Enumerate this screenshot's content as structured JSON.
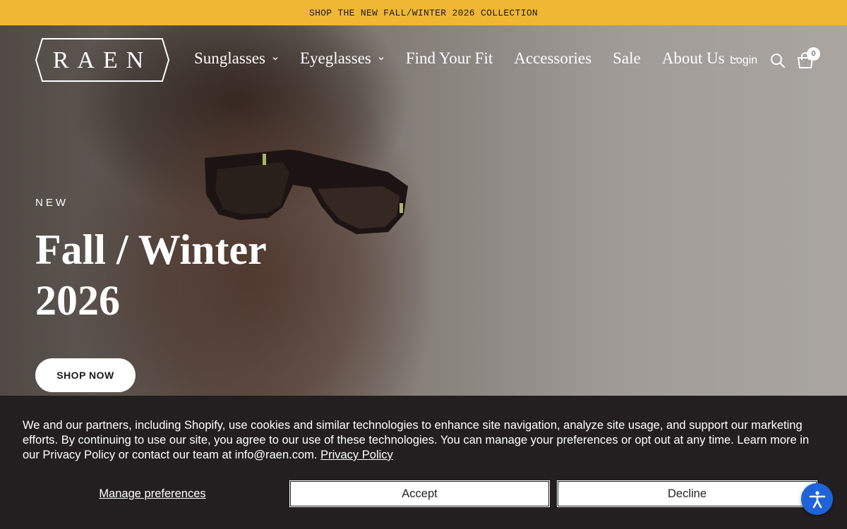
{
  "announcement": {
    "text": "SHOP THE NEW FALL/WINTER 2026 COLLECTION"
  },
  "header": {
    "logo_text": "RAEN",
    "nav": [
      {
        "label": "Sunglasses",
        "dropdown": true
      },
      {
        "label": "Eyeglasses",
        "dropdown": true
      },
      {
        "label": "Find Your Fit",
        "dropdown": false
      },
      {
        "label": "Accessories",
        "dropdown": false
      },
      {
        "label": "Sale",
        "dropdown": false
      },
      {
        "label": "About Us",
        "dropdown": true
      }
    ],
    "login_label": "Login",
    "search_icon": "search-icon",
    "cart_icon": "cart-icon",
    "cart_count": "0"
  },
  "hero": {
    "eyebrow": "NEW",
    "title_line1": "Fall / Winter",
    "title_line2": "2026",
    "cta_label": "SHOP NOW"
  },
  "cookie_banner": {
    "text": "We and our partners, including Shopify, use cookies and similar technologies to enhance site navigation, analyze site usage, and support our marketing efforts. By continuing to use our site, you agree to our use of these technologies. You can manage your preferences or opt out at any time. Learn more in our Privacy Policy or contact our team at info@raen.com.",
    "privacy_link": "Privacy Policy",
    "manage_label": "Manage preferences",
    "accept_label": "Accept",
    "decline_label": "Decline"
  },
  "accessibility_widget": {
    "icon": "accessibility-icon"
  },
  "colors": {
    "announcement_bg": "#efb733",
    "cookie_bg": "#231f20",
    "accessibility_bg": "#1e64d8"
  }
}
